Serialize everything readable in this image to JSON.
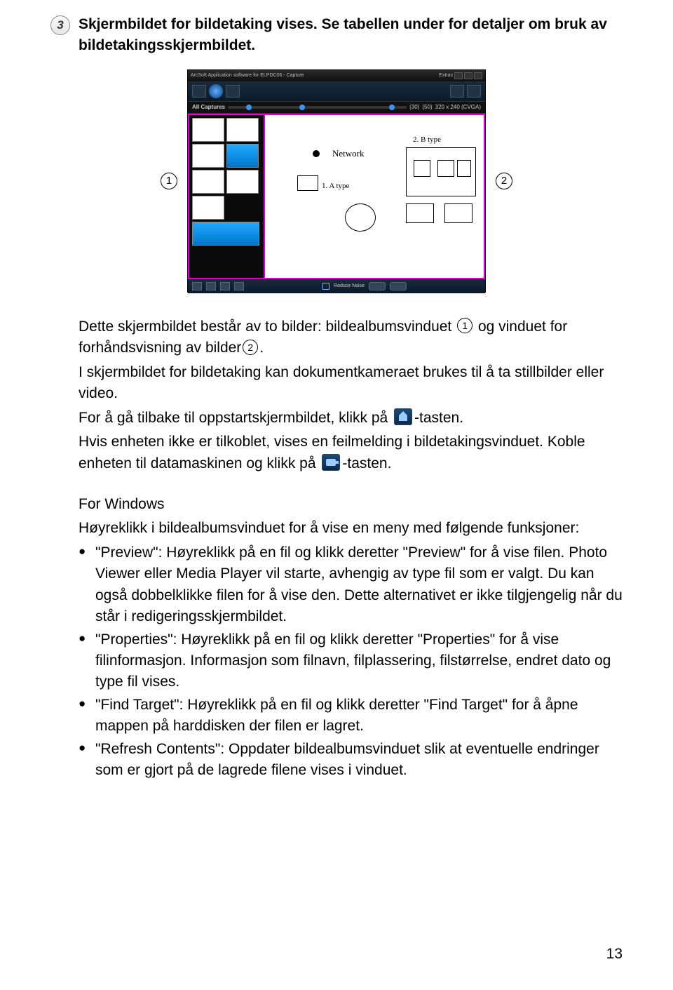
{
  "step": {
    "number": "3",
    "text": "Skjermbildet for bildetaking vises. Se tabellen under for detaljer om bruk av bildetakingsskjermbildet."
  },
  "labels": {
    "left": "1",
    "right": "2"
  },
  "app": {
    "titlebar_left": "ArcSoft Application software for ELPDC06 - Capture",
    "titlebar_right": "Extras",
    "all_captures": "All Captures",
    "val30": "(30)",
    "val50": "(50)",
    "res": "320 x 240 (CVGA)",
    "network": "Network",
    "a_type": "1. A type",
    "b_type": "2. B type",
    "reduce_noise": "Reduce\nNoise"
  },
  "para": {
    "p1_a": "Dette skjermbildet består av to bilder: bildealbumsvinduet ",
    "p1_b": " og vinduet for forhåndsvisning av bilder",
    "p1_c": ".",
    "p2": "I skjermbildet for bildetaking kan dokumentkameraet brukes til å ta stillbilder eller video.",
    "p3_a": "For å gå tilbake til oppstartskjermbildet, klikk på ",
    "p3_b": "-tasten.",
    "p4_a": "Hvis enheten ikke er tilkoblet, vises en feilmelding i bildetakingsvinduet. Koble enheten til datamaskinen og klikk på ",
    "p4_b": "-tasten."
  },
  "windows": {
    "heading": "For Windows",
    "intro": "Høyreklikk i bildealbumsvinduet for å vise en meny med følgende funksjoner:",
    "b1": "\"Preview\": Høyreklikk på en fil og klikk deretter \"Preview\" for å vise filen. Photo Viewer eller Media Player vil starte, avhengig av type fil som er valgt. Du kan også dobbelklikke filen for å vise den. Dette alternativet er ikke tilgjengelig når du står i redigeringsskjermbildet.",
    "b2": "\"Properties\": Høyreklikk på en fil og klikk deretter \"Properties\" for å vise filinformasjon. Informasjon som filnavn, filplassering, filstørrelse, endret dato og type fil vises.",
    "b3": "\"Find Target\": Høyreklikk på en fil og klikk deretter \"Find Target\" for å åpne mappen på harddisken der filen er lagret.",
    "b4": "\"Refresh Contents\": Oppdater bildealbumsvinduet slik at eventuelle endringer som er gjort på de lagrede filene vises i vinduet."
  },
  "page_number": "13"
}
